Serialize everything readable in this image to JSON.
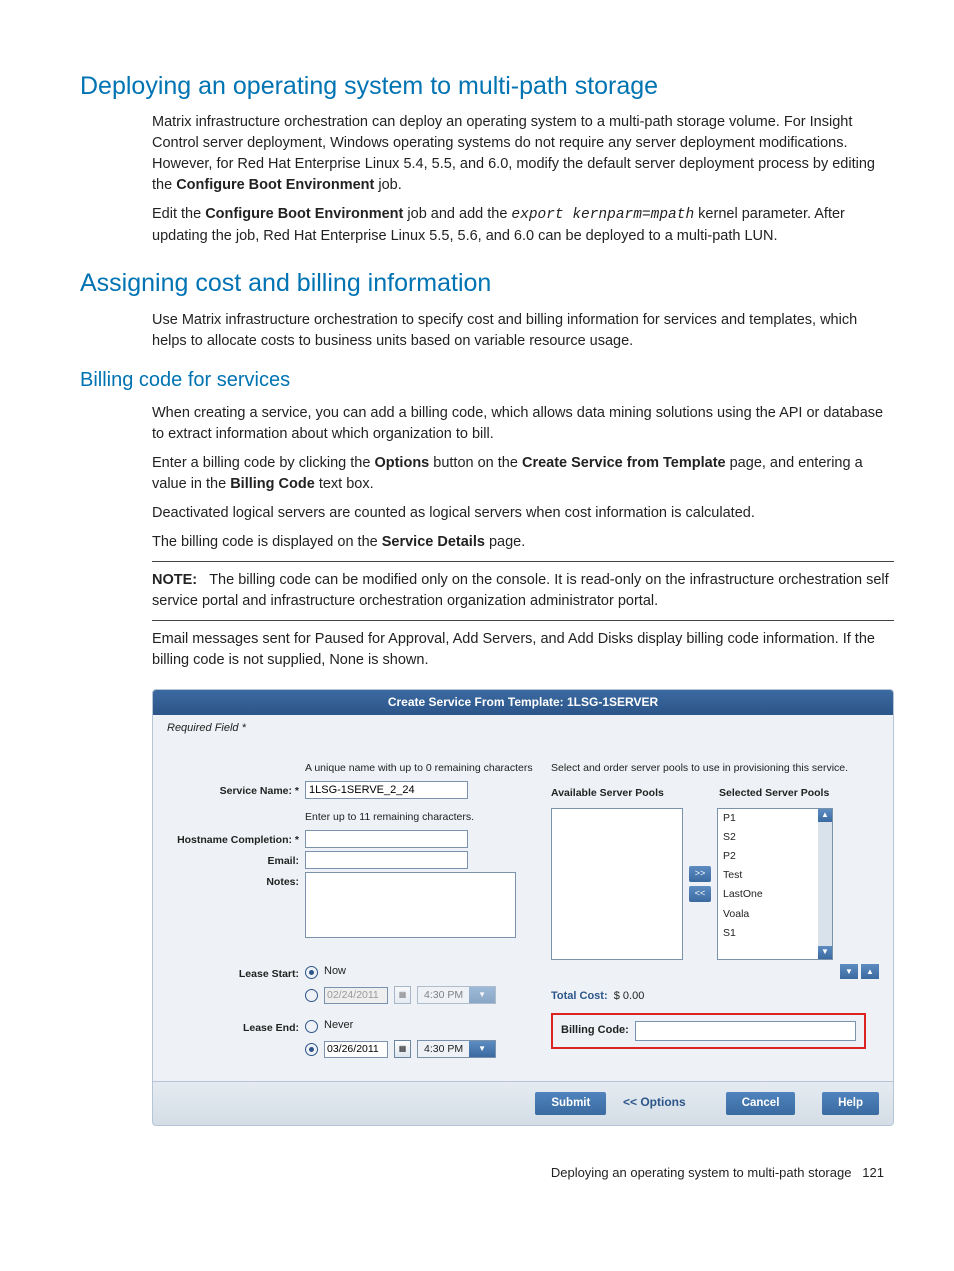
{
  "sections": {
    "deploy": {
      "title": "Deploying an operating system to multi-path storage",
      "p1a": "Matrix infrastructure orchestration can deploy an operating system to a multi-path storage volume. For Insight Control server deployment, Windows operating systems do not require any server deployment modifications. However, for Red Hat Enterprise Linux 5.4, 5.5, and 6.0, modify the default server deployment process by editing the ",
      "p1b": "Configure Boot Environment",
      "p1c": " job.",
      "p2a": "Edit the ",
      "p2b": "Configure Boot Environment",
      "p2c": " job and add the ",
      "p2code": "export kernparm=mpath",
      "p2d": " kernel parameter. After updating the job, Red Hat Enterprise Linux 5.5, 5.6, and 6.0 can be deployed to a multi-path LUN."
    },
    "assign": {
      "title": "Assigning cost and billing information",
      "p1": "Use Matrix infrastructure orchestration to specify cost and billing information for services and templates, which helps to allocate costs to business units based on variable resource usage."
    },
    "billing": {
      "title": "Billing code for services",
      "p1": "When creating a service, you can add a billing code, which allows data mining solutions using the API or database to extract information about which organization to bill.",
      "p2a": "Enter a billing code by clicking the ",
      "p2b": "Options",
      "p2c": " button on the ",
      "p2d": "Create Service from Template",
      "p2e": " page, and entering a value in the ",
      "p2f": "Billing Code",
      "p2g": " text box.",
      "p3": "Deactivated logical servers are counted as logical servers when cost information is calculated.",
      "p4a": "The billing code is displayed on the ",
      "p4b": "Service Details",
      "p4c": " page.",
      "note_label": "NOTE:",
      "note_body": "The billing code can be modified only on the console. It is read-only on the infrastructure orchestration self service portal and infrastructure orchestration organization administrator portal.",
      "p5": "Email messages sent for Paused for Approval, Add Servers, and Add Disks display billing code information. If the billing code is not supplied, None is shown."
    }
  },
  "dialog": {
    "title": "Create Service From Template: 1LSG-1SERVER",
    "required": "Required Field *",
    "left": {
      "name_hint": "A unique name with up to 0 remaining characters",
      "service_name_label": "Service Name: *",
      "service_name_value": "1LSG-1SERVE_2_24",
      "host_hint": "Enter up to 11 remaining characters.",
      "host_label": "Hostname Completion: *",
      "email_label": "Email:",
      "notes_label": "Notes:",
      "lease_start_label": "Lease Start:",
      "now": "Now",
      "date_disabled": "02/24/2011",
      "time_disabled": "4:30 PM",
      "lease_end_label": "Lease End:",
      "never": "Never",
      "date_enabled": "03/26/2011",
      "time_enabled": "4:30 PM"
    },
    "right": {
      "hint": "Select and order server pools to use in provisioning this service.",
      "avail_header": "Available Server Pools",
      "sel_header": "Selected Server Pools",
      "selected_pools": [
        "P1",
        "S2",
        "P2",
        "Test",
        "LastOne",
        "Voala",
        "S1"
      ],
      "total_cost_label": "Total Cost:",
      "total_cost_value": "$ 0.00",
      "billing_code_label": "Billing Code:"
    },
    "footer": {
      "submit": "Submit",
      "options": "<< Options",
      "cancel": "Cancel",
      "help": "Help"
    }
  },
  "footer": {
    "text": "Deploying an operating system to multi-path storage",
    "page": "121"
  }
}
